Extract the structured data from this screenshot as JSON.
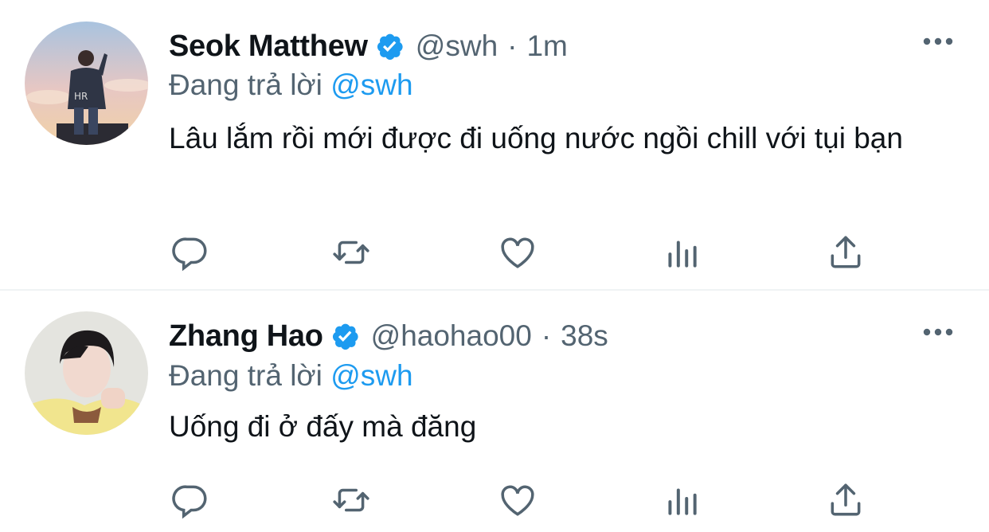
{
  "tweets": [
    {
      "name": "Seok Matthew",
      "handle": "@swh",
      "separator": "·",
      "time": "1m",
      "replying_prefix": "Đang trả lời",
      "replying_to": "@swh",
      "text": "Lâu lắm rồi mới được đi uống nước ngồi chill với tụi bạn",
      "verified": true,
      "avatar": "avatar-photo-person-sunset-sky"
    },
    {
      "name": "Zhang Hao",
      "handle": "@haohao00",
      "separator": "·",
      "time": "38s",
      "replying_prefix": "Đang trả lời",
      "replying_to": "@swh",
      "text": "Uống đi ở đấy mà đăng",
      "verified": true,
      "avatar": "avatar-photo-person-yellow-sweater"
    }
  ],
  "actions": [
    "reply-icon",
    "retweet-icon",
    "like-icon",
    "analytics-icon",
    "share-icon"
  ],
  "colors": {
    "accent": "#1d9bf0",
    "muted": "#536471",
    "text": "#0f1419",
    "divider": "#eff3f4"
  }
}
